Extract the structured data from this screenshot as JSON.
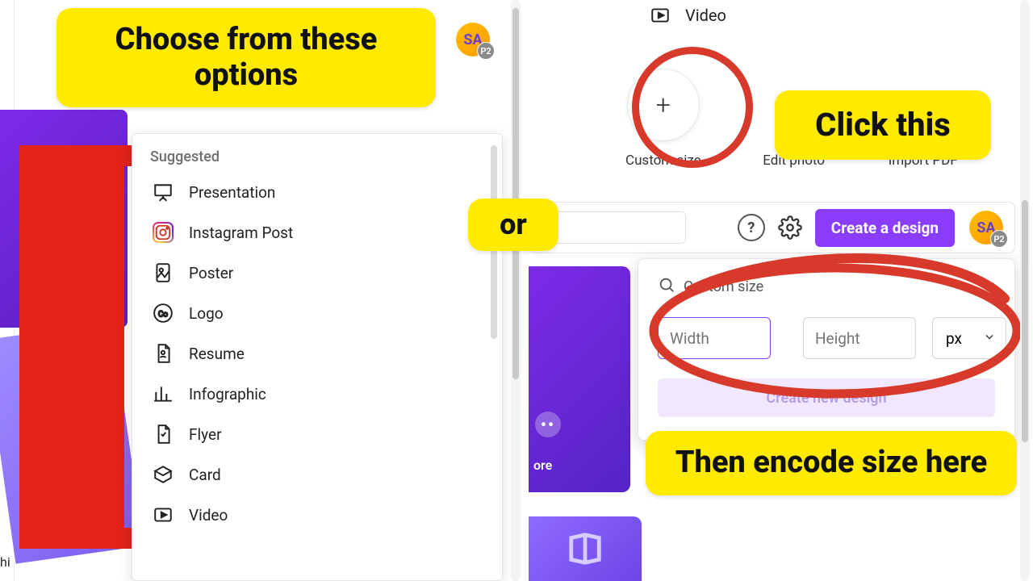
{
  "annotations": {
    "choose": "Choose from these options",
    "or": "or",
    "click_this": "Click this",
    "encode": "Then encode size here"
  },
  "avatar": {
    "initials": "SA",
    "badge": "P2"
  },
  "left_panel": {
    "heading": "Suggested",
    "items": [
      {
        "icon": "presentation-icon",
        "label": "Presentation"
      },
      {
        "icon": "instagram-icon",
        "label": "Instagram Post"
      },
      {
        "icon": "poster-icon",
        "label": "Poster"
      },
      {
        "icon": "logo-icon",
        "label": "Logo"
      },
      {
        "icon": "resume-icon",
        "label": "Resume"
      },
      {
        "icon": "infographic-icon",
        "label": "Infographic"
      },
      {
        "icon": "flyer-icon",
        "label": "Flyer"
      },
      {
        "icon": "card-icon",
        "label": "Card"
      },
      {
        "icon": "video-icon",
        "label": "Video"
      }
    ]
  },
  "top_right_list_tail": {
    "label": "Video"
  },
  "tiles": {
    "custom": {
      "label": "Custom size"
    },
    "edit": {
      "label": "Edit photo"
    },
    "import": {
      "label": "Import PDF"
    }
  },
  "header": {
    "create_label": "Create a design"
  },
  "popover": {
    "title": "Custom size",
    "width_placeholder": "Width",
    "height_placeholder": "Height",
    "unit": "px",
    "cta": "Create new design"
  },
  "banner": {
    "more": "ore"
  },
  "misc_left_caption": "hi"
}
